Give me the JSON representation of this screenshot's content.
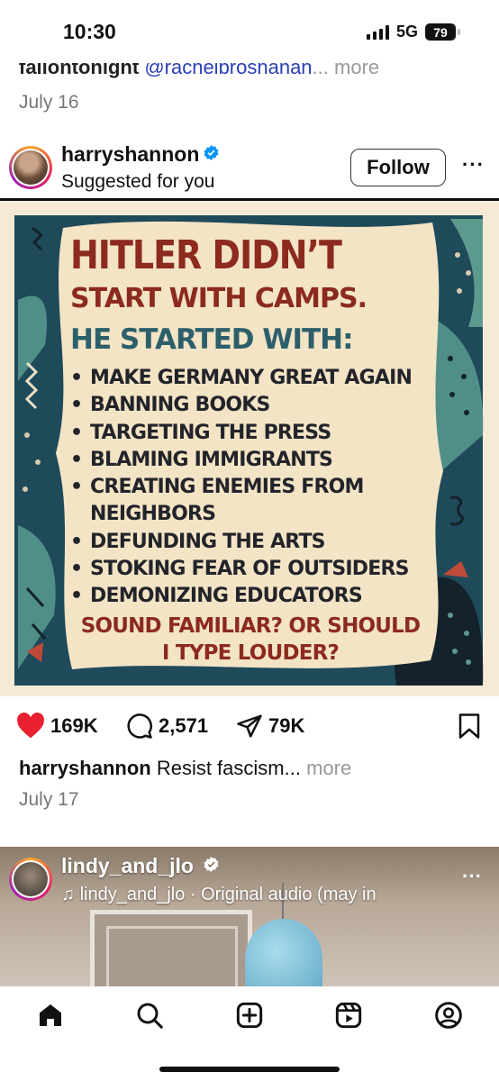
{
  "status_bar": {
    "time": "10:30",
    "network": "5G",
    "battery": "79"
  },
  "previous_post": {
    "caption_user": "fallontonight",
    "caption_mention": "@rachelbroshanan",
    "caption_more": "... more",
    "date": "July 16"
  },
  "post": {
    "username": "harryshannon",
    "subtitle": "Suggested for you",
    "follow_label": "Follow",
    "image": {
      "headline_1": "HITLER DIDN’T",
      "headline_2": "START WITH CAMPS.",
      "headline_3": "HE STARTED WITH:",
      "bullets": [
        "MAKE GERMANY GREAT AGAIN",
        "BANNING BOOKS",
        "TARGETING THE PRESS",
        "BLAMING IMMIGRANTS",
        "CREATING ENEMIES FROM NEIGHBORS",
        "DEFUNDING THE ARTS",
        "STOKING FEAR OF OUTSIDERS",
        "DEMONIZING EDUCATORS"
      ],
      "closing": "SOUND FAMILIAR? OR SHOULD\nI TYPE LOUDER?"
    },
    "likes": "169K",
    "comments": "2,571",
    "shares": "79K",
    "caption_user": "harryshannon",
    "caption_text": " Resist fascism...",
    "caption_more": " more",
    "date": "July 17"
  },
  "next_post": {
    "username": "lindy_and_jlo",
    "audio": "lindy_and_jlo · Original audio (may in"
  },
  "colors": {
    "like_red": "#e8202f",
    "poster_red": "#8c2a1f",
    "poster_teal": "#2d5f6b"
  },
  "tab_icons": [
    "home-icon",
    "search-icon",
    "create-icon",
    "reels-icon",
    "profile-icon"
  ]
}
